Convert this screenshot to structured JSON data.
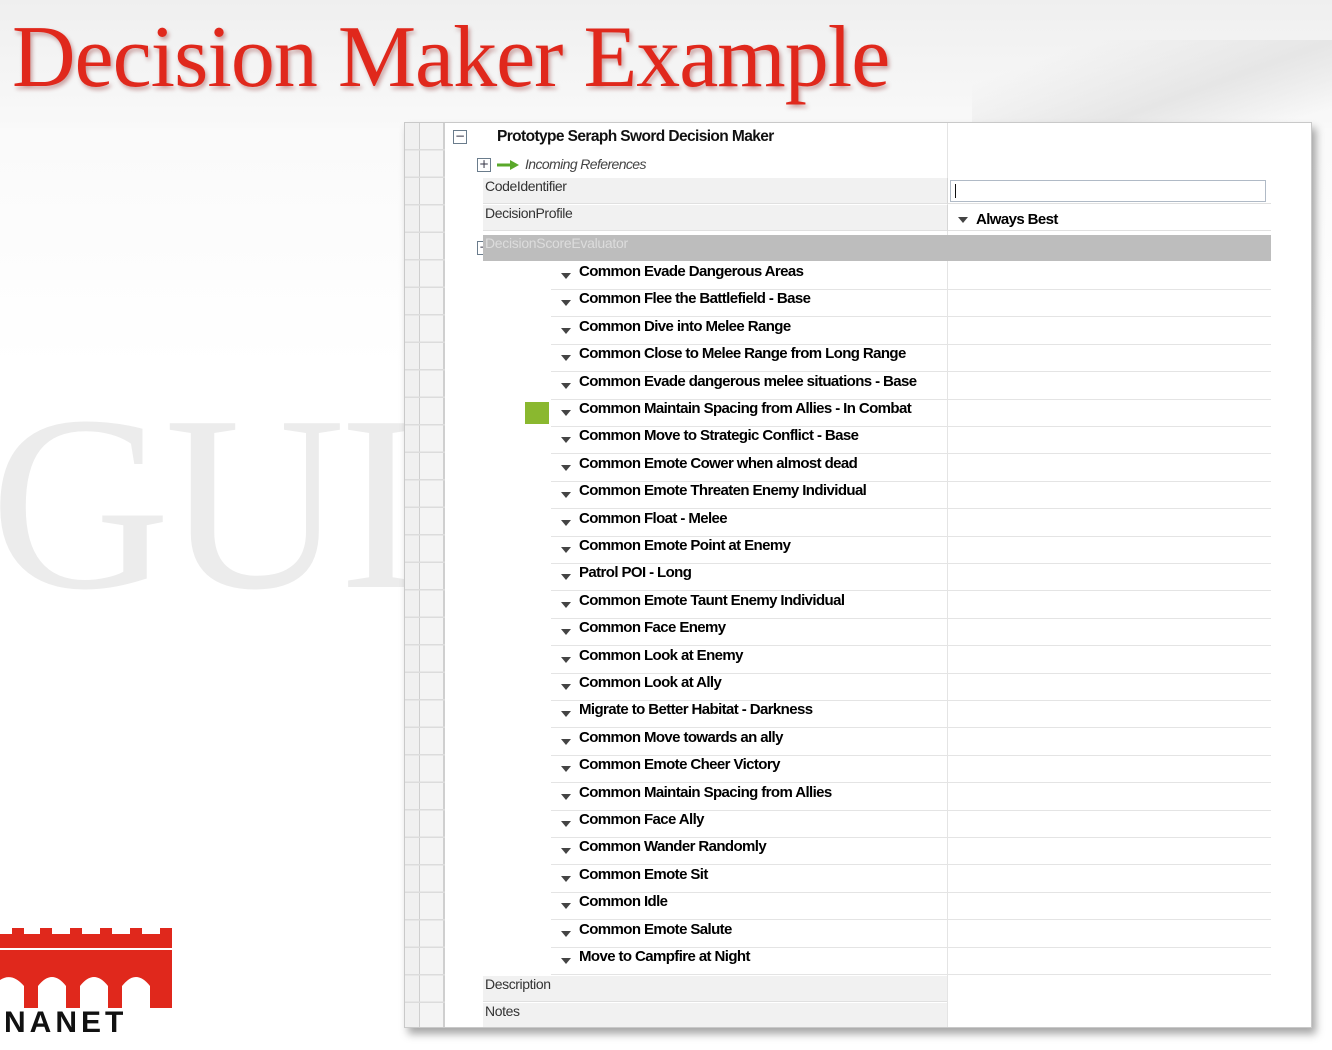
{
  "slide": {
    "title": "Decision Maker Example",
    "watermark": "GUI",
    "logo_text": "NANET"
  },
  "editor": {
    "header": "Prototype Seraph Sword Decision Maker",
    "incoming_references": "Incoming References",
    "properties": {
      "code_identifier_label": "CodeIdentifier",
      "code_identifier_value": "",
      "decision_profile_label": "DecisionProfile",
      "decision_profile_value": "Always Best",
      "evaluator_label": "DecisionScoreEvaluator",
      "description_label": "Description",
      "notes_label": "Notes"
    },
    "evaluators": [
      "Common Evade Dangerous Areas",
      "Common Flee the Battlefield - Base",
      "Common Dive into Melee Range",
      "Common Close to Melee Range from Long Range",
      "Common Evade dangerous melee situations - Base",
      "Common Maintain Spacing from Allies - In Combat",
      "Common Move to Strategic Conflict - Base",
      "Common Emote Cower when almost dead",
      "Common Emote Threaten Enemy Individual",
      "Common Float - Melee",
      "Common Emote Point at Enemy",
      "Patrol POI - Long",
      "Common Emote Taunt Enemy Individual",
      "Common Face Enemy",
      "Common Look at Enemy",
      "Common Look at Ally",
      "Migrate to Better Habitat - Darkness",
      "Common Move towards an ally",
      "Common Emote Cheer Victory",
      "Common Maintain Spacing from Allies",
      "Common Face Ally",
      "Common Wander Randomly",
      "Common Emote Sit",
      "Common Idle",
      "Common Emote Salute",
      "Move to Campfire at Night"
    ],
    "colors": {
      "title_red": "#e0281c",
      "marker_green": "#8ab82f",
      "evaluator_bar": "#bdbdbd"
    }
  }
}
